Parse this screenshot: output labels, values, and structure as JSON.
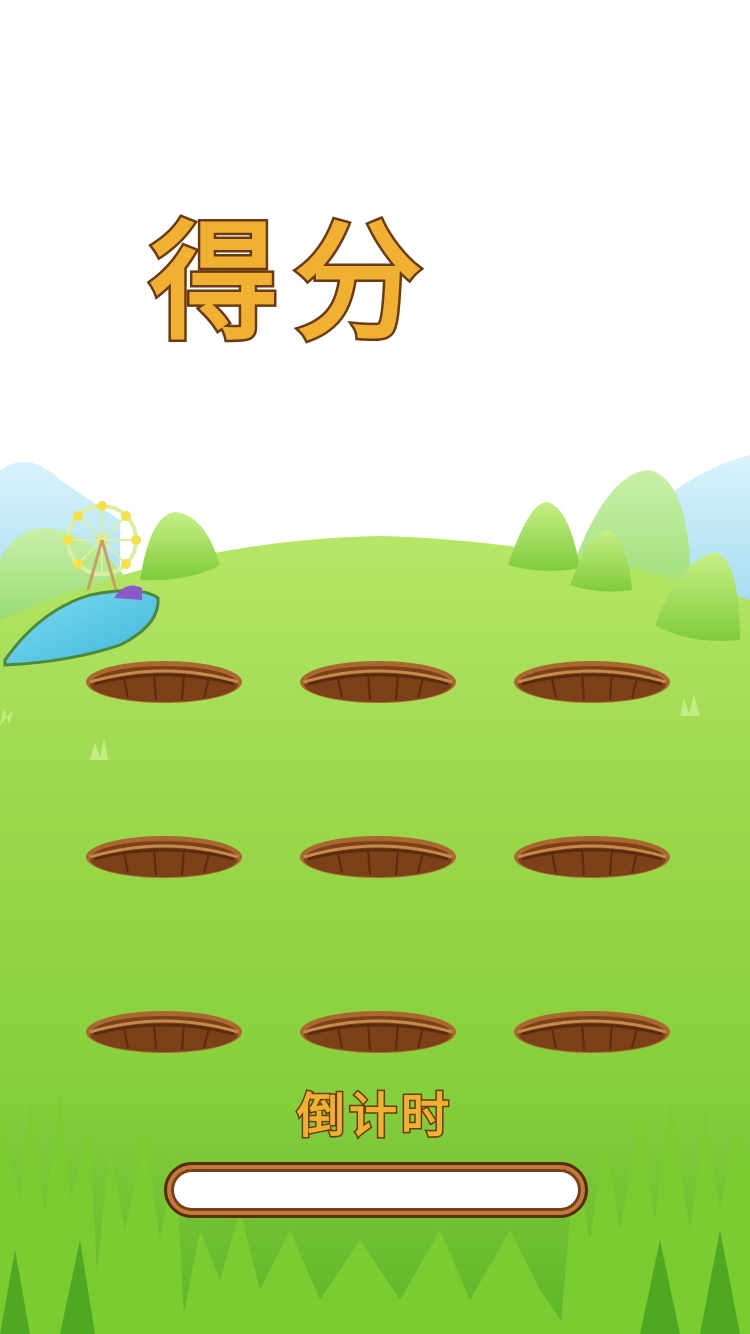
{
  "game": {
    "score_title": "得分",
    "countdown_label": "倒计时",
    "countdown_progress": 1.0,
    "holes": [
      {
        "id": "1"
      },
      {
        "id": "2"
      },
      {
        "id": "3"
      },
      {
        "id": "4"
      },
      {
        "id": "5"
      },
      {
        "id": "6"
      },
      {
        "id": "7"
      },
      {
        "id": "8"
      },
      {
        "id": "9"
      }
    ]
  },
  "colors": {
    "title_fill": "#f0b032",
    "title_outline": "#6a3a12",
    "grass_light": "#a8e050",
    "grass_dark": "#5fb82a",
    "hole_dirt": "#8a4a22",
    "bar_frame": "#7a3f1a"
  }
}
